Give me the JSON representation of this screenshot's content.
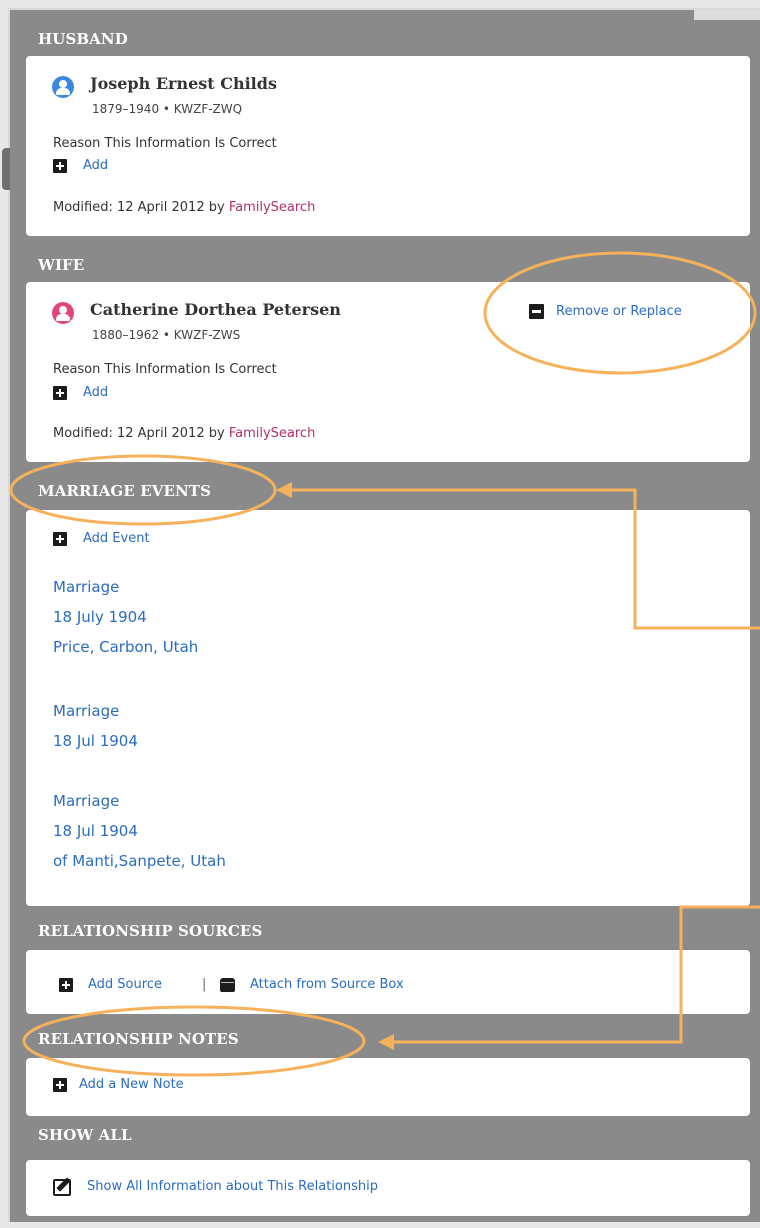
{
  "sections": {
    "husband": "HUSBAND",
    "wife": "WIFE",
    "marriage_events": "MARRIAGE EVENTS",
    "relationship_sources": "RELATIONSHIP SOURCES",
    "relationship_notes": "RELATIONSHIP NOTES",
    "show_all": "SHOW ALL"
  },
  "husband": {
    "name": "Joseph Ernest Childs",
    "lifespan_id": "1879–1940 • KWZF-ZWQ",
    "reason_label": "Reason This Information Is Correct",
    "add_label": "Add",
    "modified_prefix": "Modified: 12 April 2012  by",
    "modified_by": "FamilySearch"
  },
  "wife": {
    "name": "Catherine Dorthea Petersen",
    "lifespan_id": "1880–1962 • KWZF-ZWS",
    "remove_replace": "Remove or Replace",
    "reason_label": "Reason This Information Is Correct",
    "add_label": "Add",
    "modified_prefix": "Modified: 12 April 2012  by",
    "modified_by": "FamilySearch"
  },
  "marriage": {
    "add_event": "Add Event",
    "events": [
      {
        "type": "Marriage",
        "date": "18 July 1904",
        "place": "Price, Carbon, Utah"
      },
      {
        "type": "Marriage",
        "date": "18 Jul 1904",
        "place": ""
      },
      {
        "type": "Marriage",
        "date": "18 Jul 1904",
        "place": "of Manti,Sanpete, Utah"
      }
    ]
  },
  "sources": {
    "add_source": "Add Source",
    "separator": "|",
    "attach": "Attach from Source Box"
  },
  "notes": {
    "add_note": "Add a New Note"
  },
  "show_all": {
    "link": "Show All Information about This Relationship"
  },
  "colors": {
    "header_bg": "#8a8a8a",
    "link": "#2a6cc0",
    "familysearch": "#b0306a",
    "husband_icon": "#3a87e0",
    "wife_icon": "#e0457c",
    "annotation": "#f5b25a"
  },
  "icons": [
    "person-male-icon",
    "person-female-icon",
    "plus-icon",
    "minus-icon",
    "source-box-icon",
    "edit-icon"
  ]
}
